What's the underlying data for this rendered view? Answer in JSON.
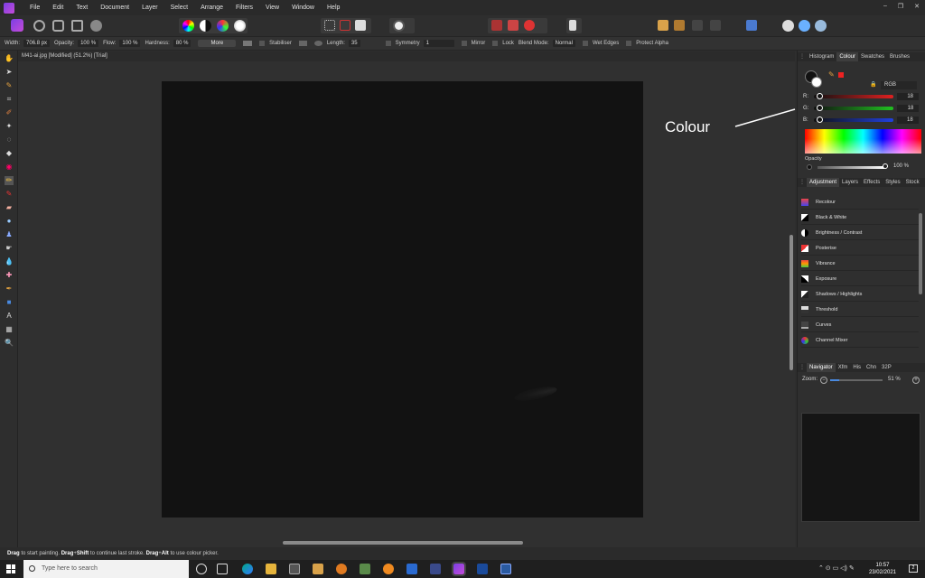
{
  "menu": [
    "File",
    "Edit",
    "Text",
    "Document",
    "Layer",
    "Select",
    "Arrange",
    "Filters",
    "View",
    "Window",
    "Help"
  ],
  "window_controls": [
    "–",
    "❐",
    "✕"
  ],
  "context": {
    "width_label": "Width:",
    "width_value": "706.8 px",
    "opacity_label": "Opacity:",
    "opacity_value": "100 %",
    "flow_label": "Flow:",
    "flow_value": "100 %",
    "hardness_label": "Hardness:",
    "hardness_value": "80 %",
    "more_label": "More",
    "stabiliser_label": "Stabiliser",
    "length_label": "Length:",
    "length_value": "35",
    "symmetry_label": "Symmetry",
    "symmetry_value": "1",
    "mirror_label": "Mirror",
    "lock_label": "Lock",
    "blend_label": "Blend Mode:",
    "blend_value": "Normal",
    "wet_edges_label": "Wet Edges",
    "protect_alpha_label": "Protect Alpha"
  },
  "document": {
    "tab_title": "M41-ai.jpg [Modified] (51.2%) [Trial]"
  },
  "status": {
    "drag1": "Drag",
    "t1": " to start painting. ",
    "drag2": "Drag",
    "plus1": "+",
    "shift": "Shift",
    "t2": " to continue last stroke. ",
    "drag3": "Drag",
    "plus2": "+",
    "alt": "Alt",
    "t3": " to use colour picker."
  },
  "panel_top": {
    "tabs": [
      "Histogram",
      "Colour",
      "Swatches",
      "Brushes"
    ],
    "active_tab": "Colour",
    "model": "RGB",
    "channels": [
      {
        "label": "R:",
        "value": "18",
        "color": "#e02020"
      },
      {
        "label": "G:",
        "value": "18",
        "color": "#20c020"
      },
      {
        "label": "B:",
        "value": "18",
        "color": "#2040e0"
      }
    ],
    "opacity_label": "Opacity",
    "opacity_value": "100 %"
  },
  "panel_mid": {
    "tabs": [
      "Adjustment",
      "Layers",
      "Effects",
      "Styles",
      "Stock"
    ],
    "active_tab": "Adjustment",
    "items": [
      "Recolour",
      "Black & White",
      "Brightness / Contrast",
      "Posterise",
      "Vibrance",
      "Exposure",
      "Shadows / Highlights",
      "Threshold",
      "Curves",
      "Channel Mixer"
    ]
  },
  "panel_nav": {
    "tabs": [
      "Navigator",
      "Xfm",
      "His",
      "Chn",
      "32P"
    ],
    "active_tab": "Navigator",
    "zoom_label": "Zoom:",
    "zoom_value": "51 %"
  },
  "annotation": {
    "text": "Colour"
  },
  "taskbar": {
    "search_placeholder": "Type here to search",
    "time": "10:57",
    "date": "23/02/2021",
    "notif_count": "2"
  }
}
